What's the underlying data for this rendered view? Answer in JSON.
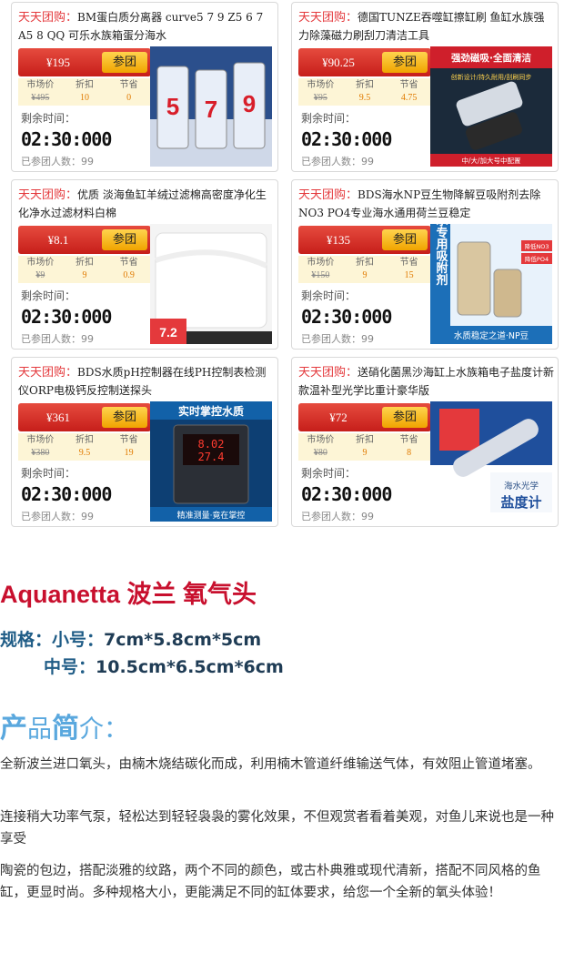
{
  "deals": [
    {
      "prefix": "天天团购：",
      "title": "BM蛋白质分离器 curve5 7 9 Z5 6 7 A5 8 QQ 可乐水族箱蛋分海水",
      "price": "¥195",
      "join_label": "参团",
      "market_label": "市场价",
      "market_price": "¥495",
      "discount_label": "折扣",
      "discount": "10",
      "save_label": "节省",
      "save": "0",
      "remain_label": "剩余时间：",
      "countdown": "02:30:000",
      "joined_text": "已参团人数：99",
      "thumb": "protein-skimmer-photo",
      "thumb_text": [
        "5",
        "7",
        "9"
      ]
    },
    {
      "prefix": "天天团购：",
      "title": "德国TUNZE吞噬缸擦缸刷 鱼缸水族强力除藻磁力刷刮刀清洁工具",
      "price": "¥90.25",
      "join_label": "参团",
      "market_label": "市场价",
      "market_price": "¥95",
      "discount_label": "折扣",
      "discount": "9.5",
      "save_label": "节省",
      "save": "4.75",
      "remain_label": "剩余时间：",
      "countdown": "02:30:000",
      "joined_text": "已参团人数：99",
      "thumb": "magnet-cleaner-photo",
      "thumb_text": [
        "强劲磁吸·全面清洁",
        "创新设计/持久耐用/刮刷同步",
        "中/大/加大号中配置"
      ]
    },
    {
      "prefix": "天天团购：",
      "title": "优质 淡海鱼缸羊绒过滤棉高密度净化生化净水过滤材料白棉",
      "price": "¥8.1",
      "join_label": "参团",
      "market_label": "市场价",
      "market_price": "¥9",
      "discount_label": "折扣",
      "discount": "9",
      "save_label": "节省",
      "save": "0.9",
      "remain_label": "剩余时间：",
      "countdown": "02:30:000",
      "joined_text": "已参团人数：99",
      "thumb": "filter-cotton-photo",
      "thumb_text": [
        "7.2"
      ]
    },
    {
      "prefix": "天天团购：",
      "title": "BDS海水NP豆生物降解豆吸附剂去除NO3 PO4专业海水通用荷兰豆稳定",
      "price": "¥135",
      "join_label": "参团",
      "market_label": "市场价",
      "market_price": "¥150",
      "discount_label": "折扣",
      "discount": "9",
      "save_label": "节省",
      "save": "15",
      "remain_label": "剩余时间：",
      "countdown": "02:30:000",
      "joined_text": "已参团人数：99",
      "thumb": "np-beads-photo",
      "thumb_text": [
        "海水专用吸附剂",
        "降低NO3",
        "降低PO4",
        "水质稳定之道·NP豆"
      ]
    },
    {
      "prefix": "天天团购：",
      "title": "BDS水质pH控制器在线PH控制表检测仪ORP电极钙反控制送探头",
      "price": "¥361",
      "join_label": "参团",
      "market_label": "市场价",
      "market_price": "¥380",
      "discount_label": "折扣",
      "discount": "9.5",
      "save_label": "节省",
      "save": "19",
      "remain_label": "剩余时间：",
      "countdown": "02:30:000",
      "joined_text": "已参团人数：99",
      "thumb": "ph-controller-photo",
      "thumb_text": [
        "实时掌控水质",
        "8.02",
        "27.4",
        "精准测量·竟在掌控"
      ]
    },
    {
      "prefix": "天天团购：",
      "title": "送硝化菌黑沙海缸上水族箱电子盐度计新款温补型光学比重计豪华版",
      "price": "¥72",
      "join_label": "参团",
      "market_label": "市场价",
      "market_price": "¥80",
      "discount_label": "折扣",
      "discount": "9",
      "save_label": "节省",
      "save": "8",
      "remain_label": "剩余时间：",
      "countdown": "02:30:000",
      "joined_text": "已参团人数：99",
      "thumb": "refractometer-photo",
      "thumb_text": [
        "海水光学",
        "盐度计"
      ]
    }
  ],
  "product": {
    "name": "Aquanetta  波兰 氧气头",
    "spec_label": "规格：",
    "size_small_label": "小号：",
    "size_small": "7cm*5.8cm*5cm",
    "size_medium_label": "中号：",
    "size_medium": "10.5cm*6.5cm*6cm"
  },
  "intro": {
    "title_parts": [
      "产",
      "品",
      "简",
      "介",
      "："
    ],
    "paragraphs": [
      "全新波兰进口氧头，由楠木烧结碳化而成，利用楠木管道纤维输送气体，有效阻止管道堵塞。",
      "连接稍大功率气泵，轻松达到轻轻袅袅的雾化效果，不但观赏者看着美观，对鱼儿来说也是一种享受",
      "陶瓷的包边，搭配淡雅的纹路，两个不同的颜色，或古朴典雅或现代清新，搭配不同风格的鱼缸，更显时尚。多种规格大小，更能满足不同的缸体要求，给您一个全新的氧头体验！"
    ]
  },
  "colors": {
    "accent_red": "#e4393c",
    "title_red": "#c8102e",
    "spec_blue": "#1f5c86",
    "intro_blue": "#5aa8de"
  }
}
